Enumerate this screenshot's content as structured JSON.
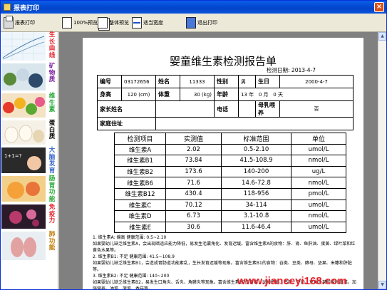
{
  "window": {
    "title": "报表打印"
  },
  "toolbar": [
    {
      "label": "报表打印",
      "icon": "printer-icon"
    },
    {
      "label": "100%预览",
      "icon": "page-icon"
    },
    {
      "label": "整体预览",
      "icon": "pages-icon"
    },
    {
      "label": "适当宽度",
      "icon": "fit-width-icon"
    },
    {
      "label": "退出打印",
      "icon": "exit-icon"
    }
  ],
  "sidebar": [
    {
      "label": "生长曲线",
      "color": "#e6202a"
    },
    {
      "label": "矿物质",
      "color": "#7a1fa2"
    },
    {
      "label": "维生素",
      "color": "#22a832"
    },
    {
      "label": "蛋白质",
      "color": "#000000"
    },
    {
      "label": "大脑发育",
      "color": "#3366cc"
    },
    {
      "label": "肠胃功能",
      "color": "#22a832"
    },
    {
      "label": "免疫力",
      "color": "#e6202a"
    },
    {
      "label": "肺功能",
      "color": "#c07a00"
    }
  ],
  "report": {
    "title": "婴童维生素检测报告单",
    "date_label": "检测日期:",
    "date": "2013-4-7",
    "info": {
      "id_label": "编号",
      "id": "03172656",
      "name_label": "姓名",
      "name": "11333",
      "sex_label": "性别",
      "sex": "男",
      "birth_label": "生日",
      "birth": "2000-4-7",
      "height_label": "身高",
      "height": "120 (cm)",
      "weight_label": "体重",
      "weight": "30 (kg)",
      "age_label": "年龄",
      "age_years": "13",
      "age_years_unit": "年",
      "age_months": "0",
      "age_months_unit": "月",
      "age_days": "0",
      "age_days_unit": "天",
      "parent_label": "家长姓名",
      "parent": "",
      "phone_label": "电话",
      "phone": "",
      "breastfed_label": "母乳喂养",
      "breastfed": "否",
      "address_label": "家庭住址",
      "address": ""
    },
    "results_headers": [
      "检测项目",
      "实测值",
      "标准范围",
      "单位"
    ],
    "results": [
      {
        "item": "维生素A",
        "value": "2.02",
        "range": "0.5-2.10",
        "unit": "umol/L"
      },
      {
        "item": "维生素B1",
        "value": "73.84",
        "range": "41.5-108.9",
        "unit": "nmol/L"
      },
      {
        "item": "维生素B2",
        "value": "173.6",
        "range": "140-200",
        "unit": "ug/L"
      },
      {
        "item": "维生素B6",
        "value": "71.6",
        "range": "14.6-72.8",
        "unit": "nmol/L"
      },
      {
        "item": "维生素B12",
        "value": "430.4",
        "range": "118-956",
        "unit": "pmol/L"
      },
      {
        "item": "维生素C",
        "value": "70.12",
        "range": "34-114",
        "unit": "umol/L"
      },
      {
        "item": "维生素D",
        "value": "6.73",
        "range": "3.1-10.8",
        "unit": "nmol/L"
      },
      {
        "item": "维生素E",
        "value": "30.6",
        "range": "11.6-46.4",
        "unit": "umol/L"
      }
    ],
    "notes": [
      "1. 维生素A: 偏高   健康范围: 0.5~2.10",
      "如果婴幼儿缺乏维生素A，会出现暗适应能力降低，易发生毛囊角化、发育迟缓。富含维生素A的食物：肝、肾、鱼肝油、蛋黄、绿叶菜和红黄色水果等。",
      "2. 维生素B1: 不足   健康范围: 41.5~108.9",
      "如果婴幼儿缺乏维生素B1，会造成胃肠道功能紊乱，生长发育迟缓等现象。富含维生素B1的食物：谷类、豆类、酵母、坚果、米糠和肝脏等。",
      "3. 维生素B2: 不足   健康范围: 140~200",
      "如果婴幼儿缺乏维生素B2，易发生口角炎、舌炎、角膜炎等现象。富含维生素B2的食物：动物肝脏、鸡蛋、牛奶、豆类及某些绿叶蔬菜。加强营养，油菜、菠菜、香菇等。"
    ]
  },
  "watermark": "www.jianceyi168.com"
}
